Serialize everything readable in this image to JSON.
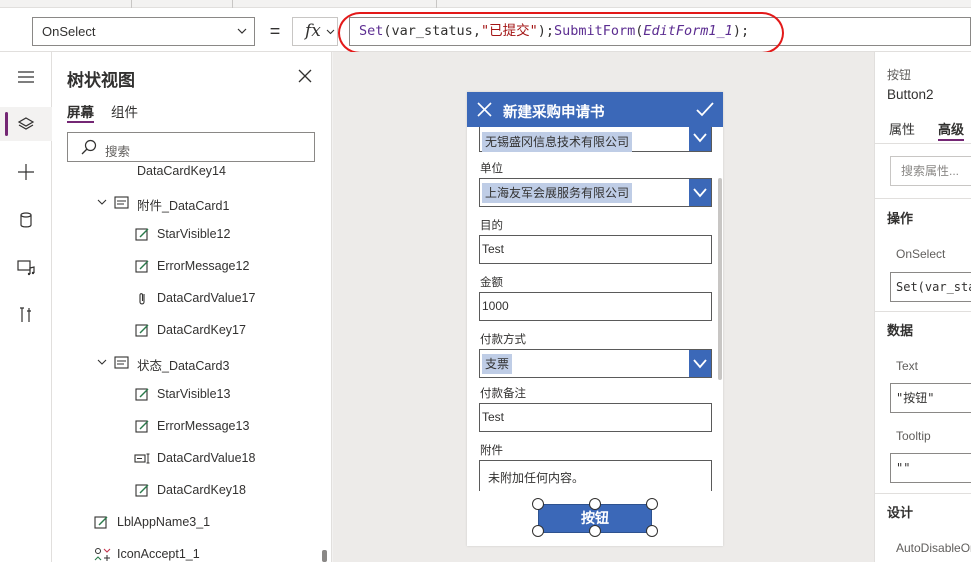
{
  "formula_bar": {
    "property": "OnSelect",
    "equals": "=",
    "fx_label": "fx",
    "formula": {
      "fn1": "Set",
      "open1": "(",
      "arg1": "var_status",
      "comma": ",",
      "arg2": "\"已提交\"",
      "close1": ");",
      "fn2": "SubmitForm",
      "open2": "(",
      "arg3": "EditForm1_1",
      "close2": ");"
    }
  },
  "rail": {
    "items": [
      {
        "icon": "hamburger-menu-icon"
      },
      {
        "icon": "layers-icon"
      },
      {
        "icon": "plus-icon"
      },
      {
        "icon": "database-icon"
      },
      {
        "icon": "media-icon"
      },
      {
        "icon": "tools-icon"
      }
    ]
  },
  "tree": {
    "title": "树状视图",
    "tabs": [
      "屏幕",
      "组件"
    ],
    "search_placeholder": "搜索",
    "rows": [
      {
        "label": "DataCardKey14",
        "icon": "edit-text-icon"
      },
      {
        "label": "附件_DataCard1",
        "icon": "card-icon"
      },
      {
        "label": "StarVisible12",
        "icon": "edit-text-icon"
      },
      {
        "label": "ErrorMessage12",
        "icon": "edit-text-icon"
      },
      {
        "label": "DataCardValue17",
        "icon": "attachment-icon"
      },
      {
        "label": "DataCardKey17",
        "icon": "edit-text-icon"
      },
      {
        "label": "状态_DataCard3",
        "icon": "card-icon"
      },
      {
        "label": "StarVisible13",
        "icon": "edit-text-icon"
      },
      {
        "label": "ErrorMessage13",
        "icon": "edit-text-icon"
      },
      {
        "label": "DataCardValue18",
        "icon": "text-input-icon"
      },
      {
        "label": "DataCardKey18",
        "icon": "edit-text-icon"
      },
      {
        "label": "LblAppName3_1",
        "icon": "edit-text-icon"
      },
      {
        "label": "IconAccept1_1",
        "icon": "icon-control-icon"
      }
    ]
  },
  "form": {
    "title": "新建采购申请书",
    "company_value": "无锡盛冈信息技术有限公司",
    "unit_label": "单位",
    "unit_value": "上海友军会展服务有限公司",
    "purpose_label": "目的",
    "purpose_value": "Test",
    "amount_label": "金额",
    "amount_value": "1000",
    "pay_method_label": "付款方式",
    "pay_method_value": "支票",
    "pay_note_label": "付款备注",
    "pay_note_value": "Test",
    "attach_label": "附件",
    "attach_value": "未附加任何内容。",
    "button_label": "按钮"
  },
  "props": {
    "type": "按钮",
    "name": "Button2",
    "tabs": [
      "属性",
      "高级"
    ],
    "search_placeholder": "搜索属性...",
    "section_action": "操作",
    "onselect_label": "OnSelect",
    "onselect_value": "Set(var_status,",
    "section_data": "数据",
    "text_label": "Text",
    "text_value": "\"按钮\"",
    "tooltip_label": "Tooltip",
    "tooltip_value": "\"\"",
    "section_design": "设计",
    "autodisable_label": "AutoDisableOnSelect"
  },
  "colors": {
    "accent": "#742774",
    "form_header": "#3b68b8",
    "highlight_ring": "#e31919"
  }
}
